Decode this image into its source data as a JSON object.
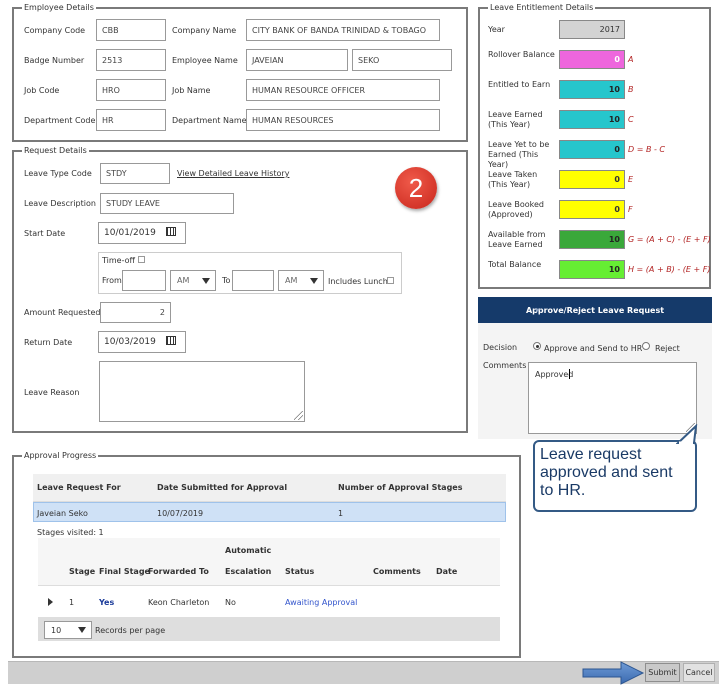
{
  "employee": {
    "legend": "Employee Details",
    "company_code_label": "Company Code",
    "company_code": "CBB",
    "company_name_label": "Company Name",
    "company_name": "CITY BANK OF BANDA TRINIDAD & TOBAGO",
    "badge_label": "Badge Number",
    "badge": "2513",
    "employee_name_label": "Employee Name",
    "first_name": "JAVEIAN",
    "last_name": "SEKO",
    "job_code_label": "Job Code",
    "job_code": "HRO",
    "job_name_label": "Job Name",
    "job_name": "HUMAN RESOURCE OFFICER",
    "dept_code_label": "Department Code",
    "dept_code": "HR",
    "dept_name_label": "Department Name",
    "dept_name": "HUMAN RESOURCES"
  },
  "entitlement": {
    "legend": "Leave Entitlement Details",
    "rows": [
      {
        "label": "Year",
        "value": "2017",
        "formula": "",
        "color": "#d3d3d3"
      },
      {
        "label": "Rollover Balance",
        "value": "0",
        "formula": "A",
        "color": "#ee66dd"
      },
      {
        "label": "Entitled to Earn",
        "value": "10",
        "formula": "B",
        "color": "#26c6cc"
      },
      {
        "label": "Leave Earned (This Year)",
        "value": "10",
        "formula": "C",
        "color": "#26c6cc"
      },
      {
        "label": "Leave Yet to be Earned (This Year)",
        "value": "0",
        "formula": "D = B - C",
        "color": "#26c6cc"
      },
      {
        "label": "Leave Taken (This Year)",
        "value": "0",
        "formula": "E",
        "color": "#ffff00"
      },
      {
        "label": "Leave Booked (Approved)",
        "value": "0",
        "formula": "F",
        "color": "#ffff00"
      },
      {
        "label": "Available from Leave Earned",
        "value": "10",
        "formula": "G = (A + C) - (E + F)",
        "color": "#3aa83a"
      },
      {
        "label": "Total Balance",
        "value": "10",
        "formula": "H = (A + B) - (E + F)",
        "color": "#66ee33"
      }
    ]
  },
  "request": {
    "legend": "Request Details",
    "leave_type_label": "Leave Type Code",
    "leave_type": "STDY",
    "history_link": "View Detailed Leave History",
    "desc_label": "Leave Description",
    "desc": "STUDY LEAVE",
    "start_label": "Start Date",
    "start": "10/01/2019",
    "timeoff_label": "Time-off",
    "from_label": "From",
    "to_label": "To",
    "am1": "AM",
    "am2": "AM",
    "includes_lunch_label": "Includes Lunch",
    "amount_label": "Amount Requested",
    "amount": "2",
    "return_label": "Return Date",
    "return": "10/03/2019",
    "reason_label": "Leave Reason",
    "step_badge": "2"
  },
  "approve": {
    "title": "Approve/Reject Leave Request",
    "decision_label": "Decision",
    "opt_approve": "Approve and Send to HR",
    "opt_reject": "Reject",
    "comments_label": "Comments",
    "comments": "Approved",
    "callout": "Leave request approved and sent to HR."
  },
  "progress": {
    "legend": "Approval Progress",
    "headers": [
      "Leave Request For",
      "Date Submitted for Approval",
      "Number of Approval Stages"
    ],
    "row": [
      "Javeian Seko",
      "10/07/2019",
      "1"
    ],
    "stages_visited": "Stages visited: 1",
    "stage_headers": [
      "Stage",
      "Final Stage",
      "Forwarded To",
      "Automatic",
      "Escalation",
      "Status",
      "Comments",
      "Date"
    ],
    "stage_row": [
      "1",
      "Yes",
      "Keon Charleton",
      "No",
      "Awaiting Approval",
      "",
      ""
    ],
    "page_size": "10",
    "records_label": "Records per page"
  },
  "footer": {
    "submit": "Submit",
    "cancel": "Cancel"
  }
}
